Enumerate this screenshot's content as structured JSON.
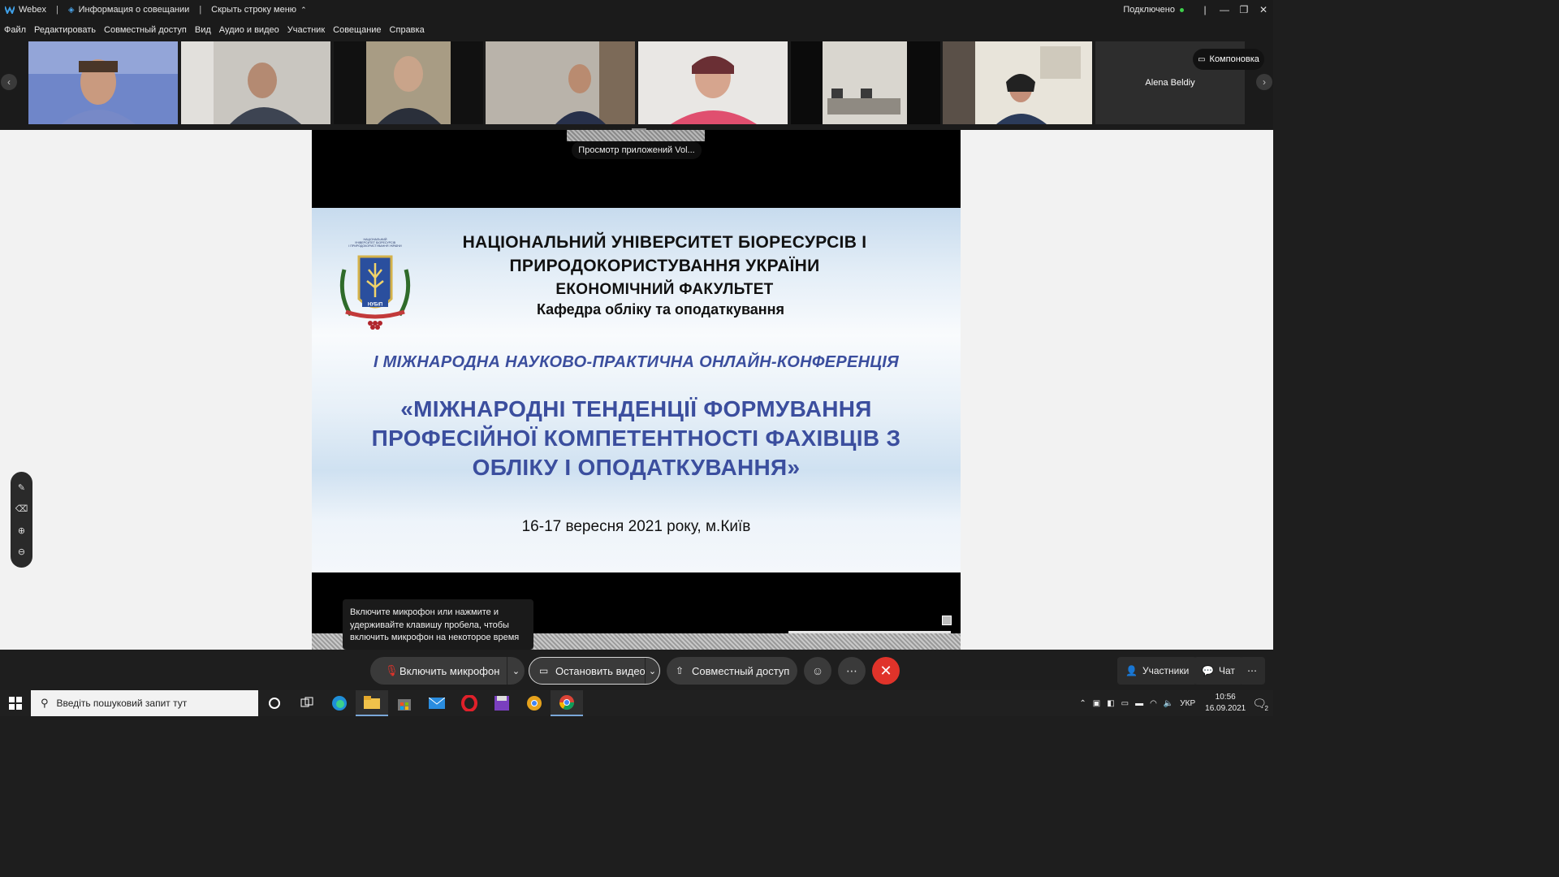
{
  "titlebar": {
    "app_name": "Webex",
    "meeting_info": "Информация о совещании",
    "hide_menu": "Скрыть строку меню",
    "status": "Подключено"
  },
  "menu": [
    "Файл",
    "Редактировать",
    "Совместный доступ",
    "Вид",
    "Аудио и видео",
    "Участник",
    "Совещание",
    "Справка"
  ],
  "filmstrip": {
    "name_tile": "Alena Beldiy",
    "layout_button": "Компоновка"
  },
  "apps_tooltip": "Просмотр приложений Vol...",
  "slide": {
    "university": "НАЦІОНАЛЬНИЙ УНІВЕРСИТЕТ БІОРЕСУРСІВ І ПРИРОДОКОРИСТУВАННЯ УКРАЇНИ",
    "faculty": "ЕКОНОМІЧНИЙ ФАКУЛЬТЕТ",
    "department": "Кафедра обліку та оподаткування",
    "conference": "І МІЖНАРОДНА  НАУКОВО-ПРАКТИЧНА ОНЛАЙН-КОНФЕРЕНЦІЯ",
    "theme": "«МІЖНАРОДНІ ТЕНДЕНЦІЇ ФОРМУВАННЯ ПРОФЕСІЙНОЇ КОМПЕТЕНТНОСТІ ФАХІВЦІВ З ОБЛІКУ І ОПОДАТКУВАННЯ»",
    "date": "16-17 вересня 2021 року, м.Київ",
    "logo_text": "НУБіП",
    "logo_caption": "НАЦІОНАЛЬНИЙ УНІВЕРСИТЕТ БІОРЕСУРСІВ І ПРИРОДОКОРИСТУВАННЯ УКРАЇНИ"
  },
  "mic_tooltip": "Включите микрофон или нажмите и удерживайте клавишу пробела, чтобы включить микрофон на некоторое время",
  "controls": {
    "mic": "Включить микрофон",
    "video": "Остановить видео",
    "share": "Совместный доступ",
    "participants": "Участники",
    "chat": "Чат"
  },
  "taskbar": {
    "search_placeholder": "Введіть пошуковий запит тут",
    "lang": "УКР",
    "time": "10:56",
    "date": "16.09.2021",
    "notifications": "2"
  },
  "colors": {
    "accent_blue": "#3b4e9e",
    "end_red": "#e0332a",
    "connected": "#3ecf4a"
  }
}
